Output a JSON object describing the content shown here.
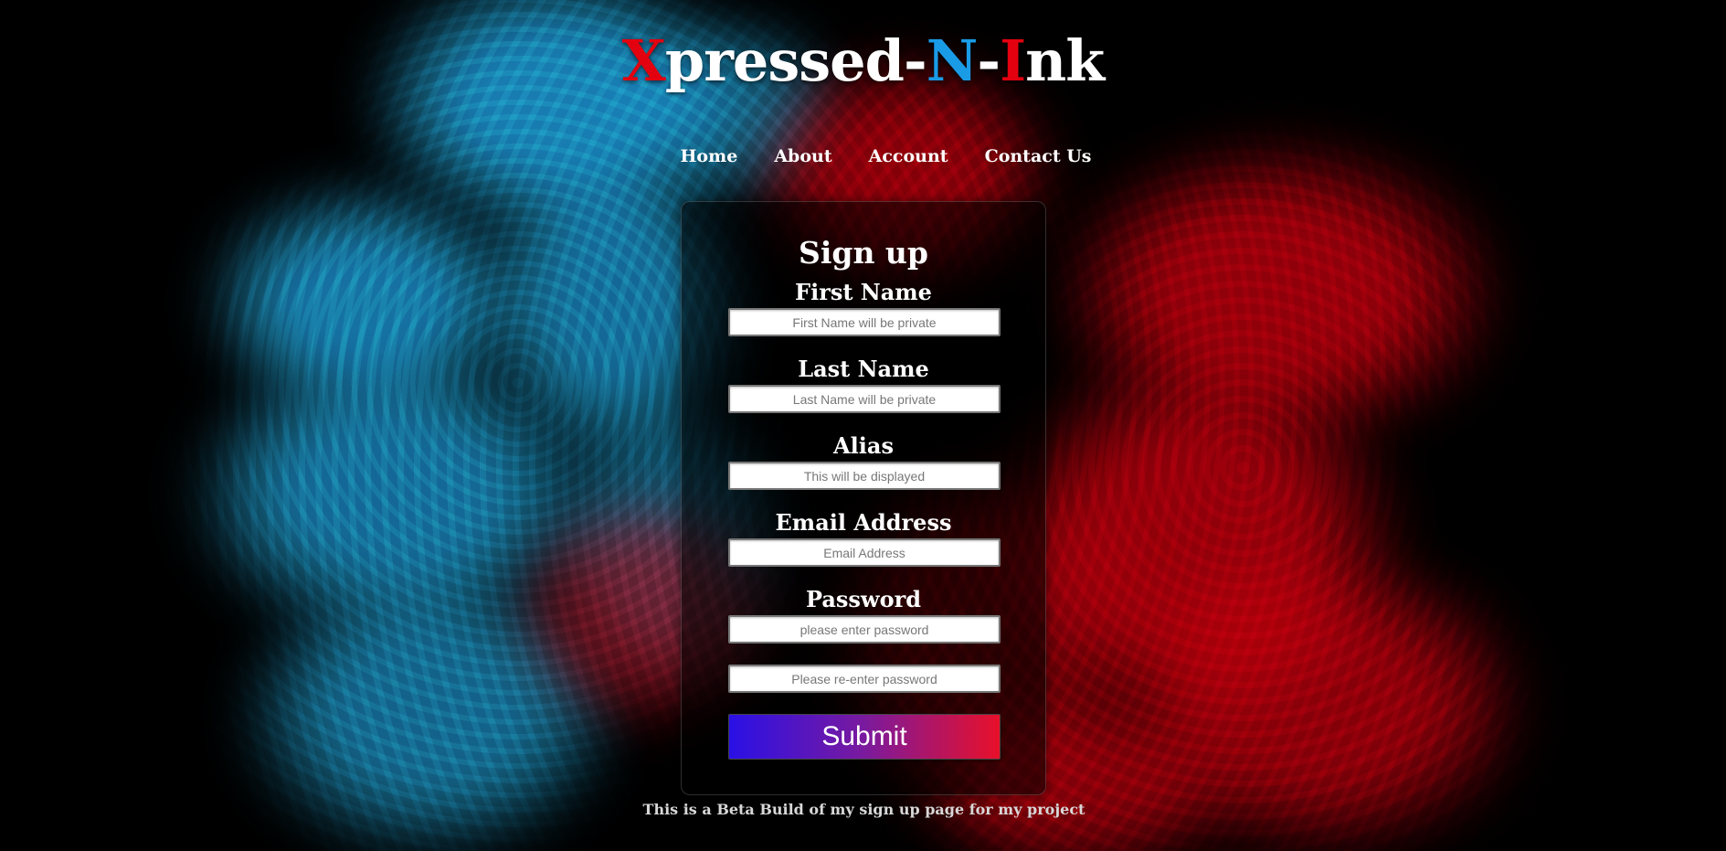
{
  "logo": {
    "x": "X",
    "pressed": "pressed-",
    "n": "N",
    "dash": "-",
    "i": "I",
    "nk": "nk"
  },
  "colors": {
    "logo_red": "#e3000f",
    "logo_blue": "#1a9be6",
    "ink_blue": "#21a9de",
    "ink_red": "#c8000e",
    "submit_gradient_start": "#2a10e6",
    "submit_gradient_end": "#e8102a"
  },
  "nav": {
    "home": "Home",
    "about": "About",
    "account": "Account",
    "contact": "Contact Us"
  },
  "form": {
    "title": "Sign up",
    "first_name_label": "First Name",
    "first_name_placeholder": "First Name will be private",
    "last_name_label": "Last Name",
    "last_name_placeholder": "Last Name will be private",
    "alias_label": "Alias",
    "alias_placeholder": "This will be displayed",
    "email_label": "Email Address",
    "email_placeholder": "Email Address",
    "password_label": "Password",
    "password_placeholder": "please enter password",
    "password_confirm_placeholder": "Please re-enter password",
    "submit_label": "Submit"
  },
  "footer": {
    "note": "This is a Beta Build of my sign up page for my project"
  }
}
